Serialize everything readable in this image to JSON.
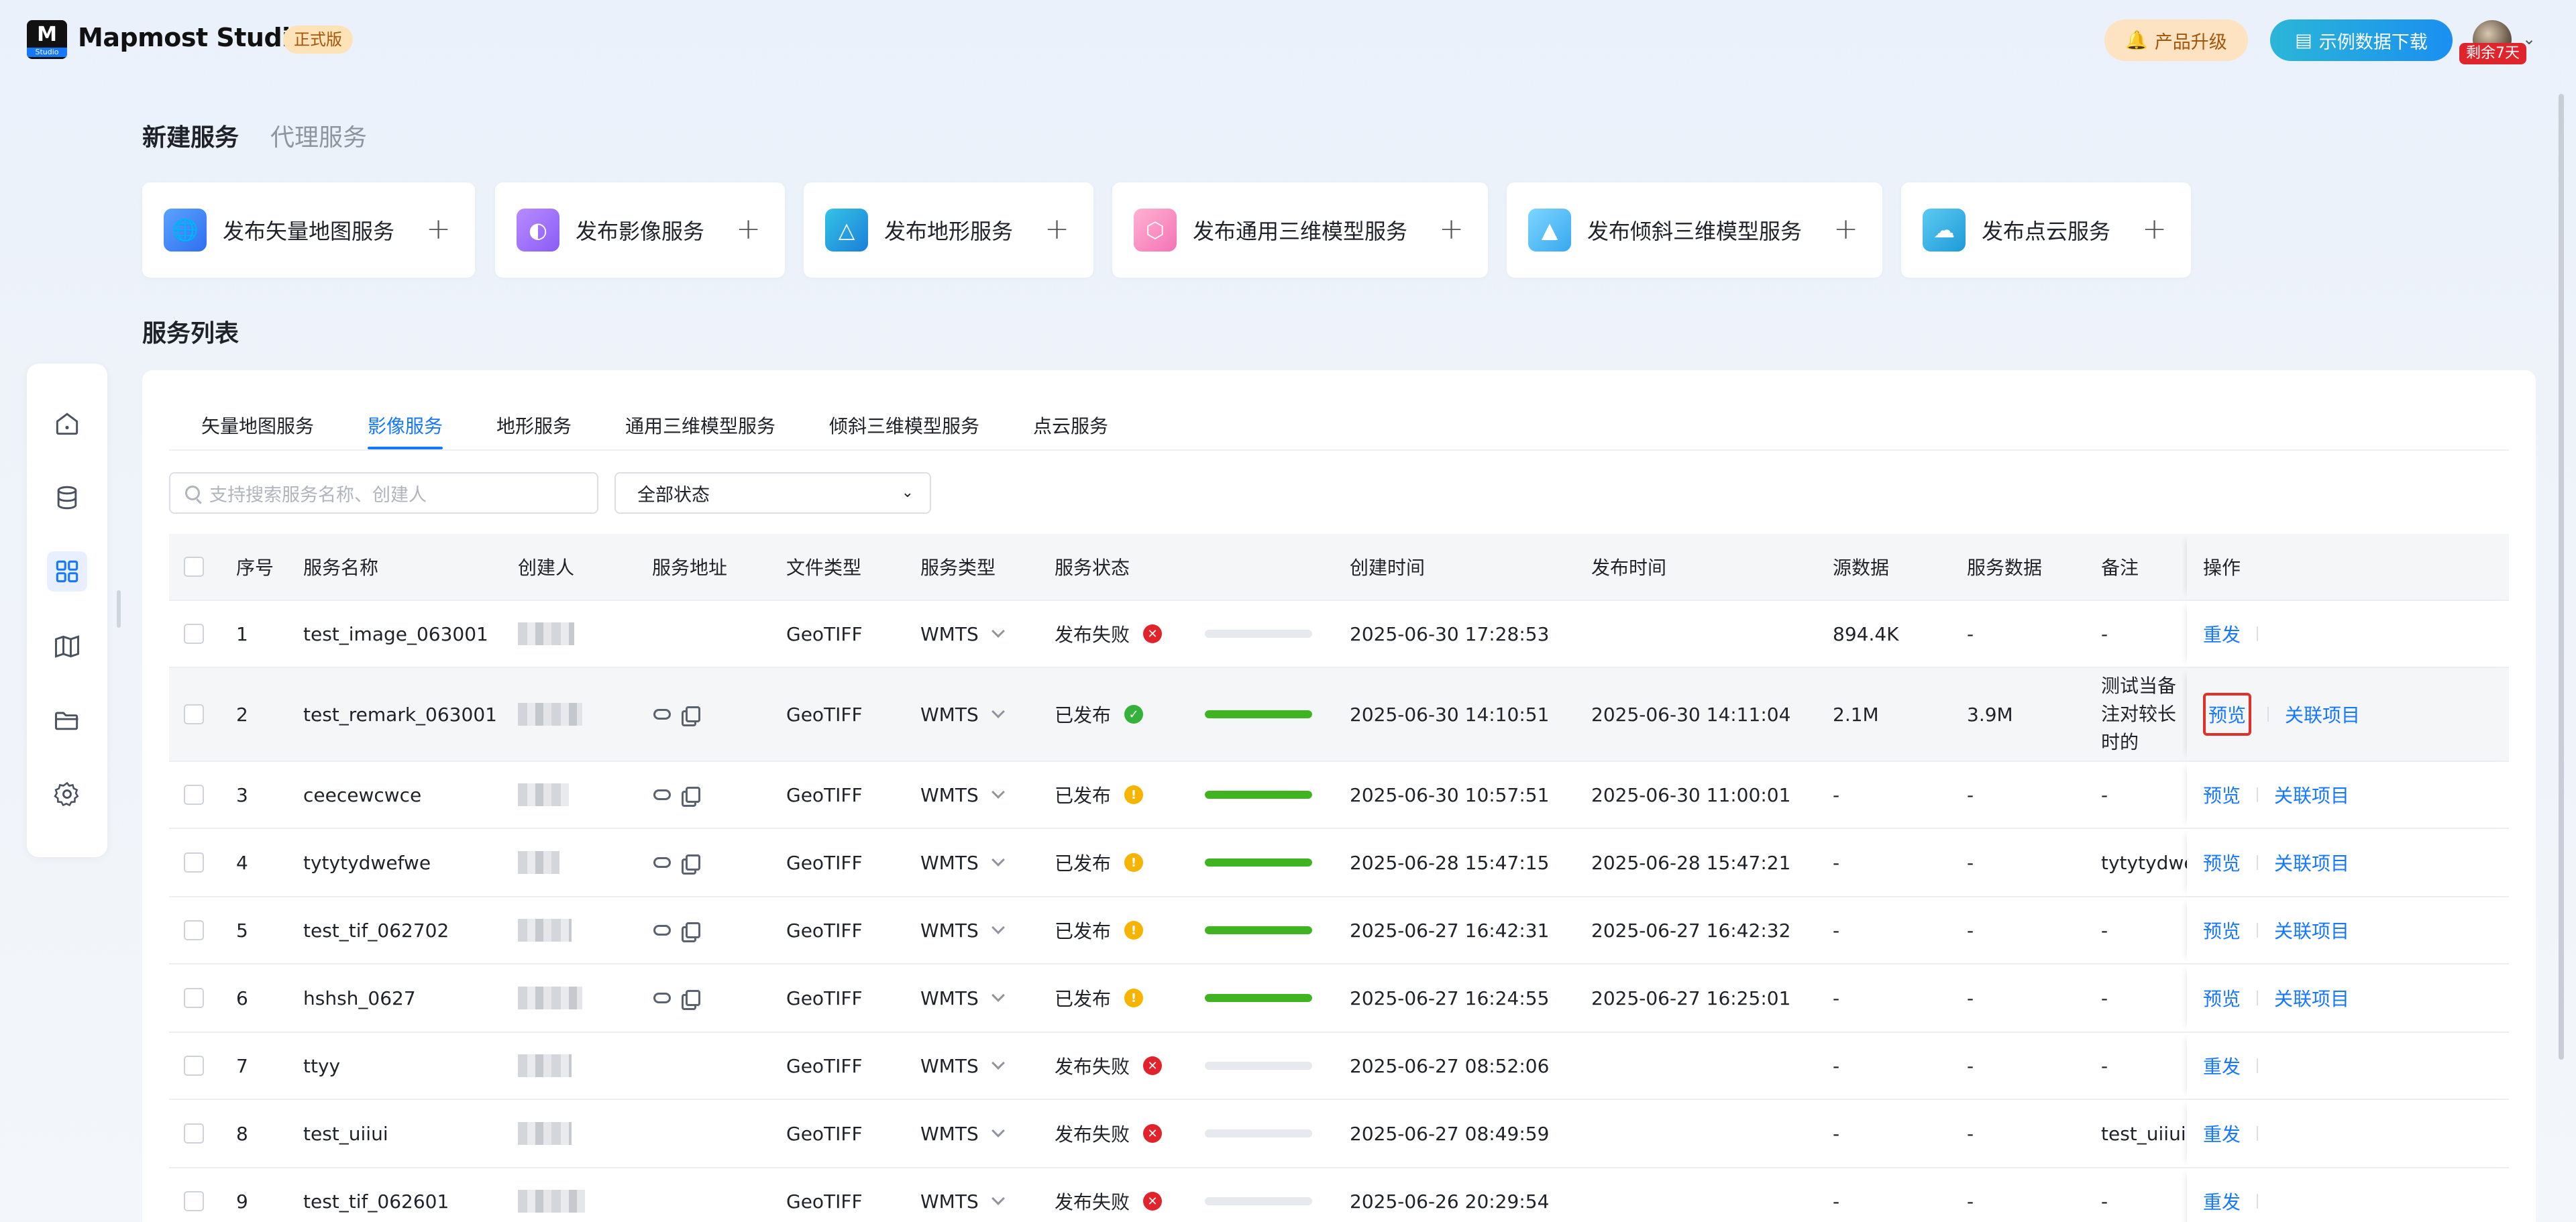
{
  "header": {
    "logo_text": "M",
    "logo_sub": "Studio",
    "brand": "Mapmost Studio",
    "edition": "正式版",
    "upgrade_label": "产品升级",
    "download_label": "示例数据下载",
    "trial_badge": "剩余7天"
  },
  "service_tabs": {
    "create": "新建服务",
    "proxy": "代理服务"
  },
  "publish_cards": [
    {
      "label": "发布矢量地图服务",
      "icon": "globe-icon",
      "color": "#3b82f6"
    },
    {
      "label": "发布影像服务",
      "icon": "image-globe-icon",
      "color": "#8b5cf6"
    },
    {
      "label": "发布地形服务",
      "icon": "terrain-icon",
      "color": "#0ea5e9"
    },
    {
      "label": "发布通用三维模型服务",
      "icon": "cube-icon",
      "color": "#f472b6"
    },
    {
      "label": "发布倾斜三维模型服务",
      "icon": "tilt-model-icon",
      "color": "#38bdf8"
    },
    {
      "label": "发布点云服务",
      "icon": "cloud-icon",
      "color": "#22a6e0"
    }
  ],
  "list_title": "服务列表",
  "list_tabs": [
    "矢量地图服务",
    "影像服务",
    "地形服务",
    "通用三维模型服务",
    "倾斜三维模型服务",
    "点云服务"
  ],
  "active_tab": "影像服务",
  "search": {
    "placeholder": "支持搜索服务名称、创建人"
  },
  "status_filter": {
    "value": "全部状态"
  },
  "columns": [
    "序号",
    "服务名称",
    "创建人",
    "服务地址",
    "文件类型",
    "服务类型",
    "服务状态",
    "创建时间",
    "发布时间",
    "源数据",
    "服务数据",
    "备注",
    "操作"
  ],
  "rows": [
    {
      "no": "1",
      "name": "test_image_063001",
      "file_type": "GeoTIFF",
      "service_type": "WMTS",
      "status": "发布失败",
      "status_kind": "fail",
      "progress": 0,
      "created": "2025-06-30 17:28:53",
      "published": "",
      "source": "894.4K",
      "service_data": "-",
      "remark": "-",
      "ops": [
        "重发"
      ],
      "has_address": false
    },
    {
      "no": "2",
      "name": "test_remark_063001",
      "file_type": "GeoTIFF",
      "service_type": "WMTS",
      "status": "已发布",
      "status_kind": "ok",
      "progress": 1,
      "created": "2025-06-30 14:10:51",
      "published": "2025-06-30 14:11:04",
      "source": "2.1M",
      "service_data": "3.9M",
      "remark": "测试当备注对较长时的",
      "ops": [
        "预览",
        "关联项目"
      ],
      "has_address": true
    },
    {
      "no": "3",
      "name": "ceecewcwce",
      "file_type": "GeoTIFF",
      "service_type": "WMTS",
      "status": "已发布",
      "status_kind": "warn",
      "progress": 1,
      "created": "2025-06-30 10:57:51",
      "published": "2025-06-30 11:00:01",
      "source": "-",
      "service_data": "-",
      "remark": "-",
      "ops": [
        "预览",
        "关联项目"
      ],
      "has_address": true
    },
    {
      "no": "4",
      "name": "tytytydwefwe",
      "file_type": "GeoTIFF",
      "service_type": "WMTS",
      "status": "已发布",
      "status_kind": "warn",
      "progress": 1,
      "created": "2025-06-28 15:47:15",
      "published": "2025-06-28 15:47:21",
      "source": "-",
      "service_data": "-",
      "remark": "tytytydwe",
      "ops": [
        "预览",
        "关联项目"
      ],
      "has_address": true
    },
    {
      "no": "5",
      "name": "test_tif_062702",
      "file_type": "GeoTIFF",
      "service_type": "WMTS",
      "status": "已发布",
      "status_kind": "warn",
      "progress": 1,
      "created": "2025-06-27 16:42:31",
      "published": "2025-06-27 16:42:32",
      "source": "-",
      "service_data": "-",
      "remark": "-",
      "ops": [
        "预览",
        "关联项目"
      ],
      "has_address": true
    },
    {
      "no": "6",
      "name": "hshsh_0627",
      "file_type": "GeoTIFF",
      "service_type": "WMTS",
      "status": "已发布",
      "status_kind": "warn",
      "progress": 1,
      "created": "2025-06-27 16:24:55",
      "published": "2025-06-27 16:25:01",
      "source": "-",
      "service_data": "-",
      "remark": "-",
      "ops": [
        "预览",
        "关联项目"
      ],
      "has_address": true
    },
    {
      "no": "7",
      "name": "ttyy",
      "file_type": "GeoTIFF",
      "service_type": "WMTS",
      "status": "发布失败",
      "status_kind": "fail",
      "progress": 0,
      "created": "2025-06-27 08:52:06",
      "published": "",
      "source": "-",
      "service_data": "-",
      "remark": "-",
      "ops": [
        "重发"
      ],
      "has_address": false
    },
    {
      "no": "8",
      "name": "test_uiiui",
      "file_type": "GeoTIFF",
      "service_type": "WMTS",
      "status": "发布失败",
      "status_kind": "fail",
      "progress": 0,
      "created": "2025-06-27 08:49:59",
      "published": "",
      "source": "-",
      "service_data": "-",
      "remark": "test_uiiui",
      "ops": [
        "重发"
      ],
      "has_address": false
    },
    {
      "no": "9",
      "name": "test_tif_062601",
      "file_type": "GeoTIFF",
      "service_type": "WMTS",
      "status": "发布失败",
      "status_kind": "fail",
      "progress": 0,
      "created": "2025-06-26 20:29:54",
      "published": "",
      "source": "-",
      "service_data": "-",
      "remark": "-",
      "ops": [
        "重发"
      ],
      "has_address": false
    }
  ],
  "colors": {
    "accent": "#1677ff",
    "success": "#34b23a",
    "warning": "#f6b400",
    "danger": "#e2232b",
    "highlight_box": "#e0302a"
  }
}
